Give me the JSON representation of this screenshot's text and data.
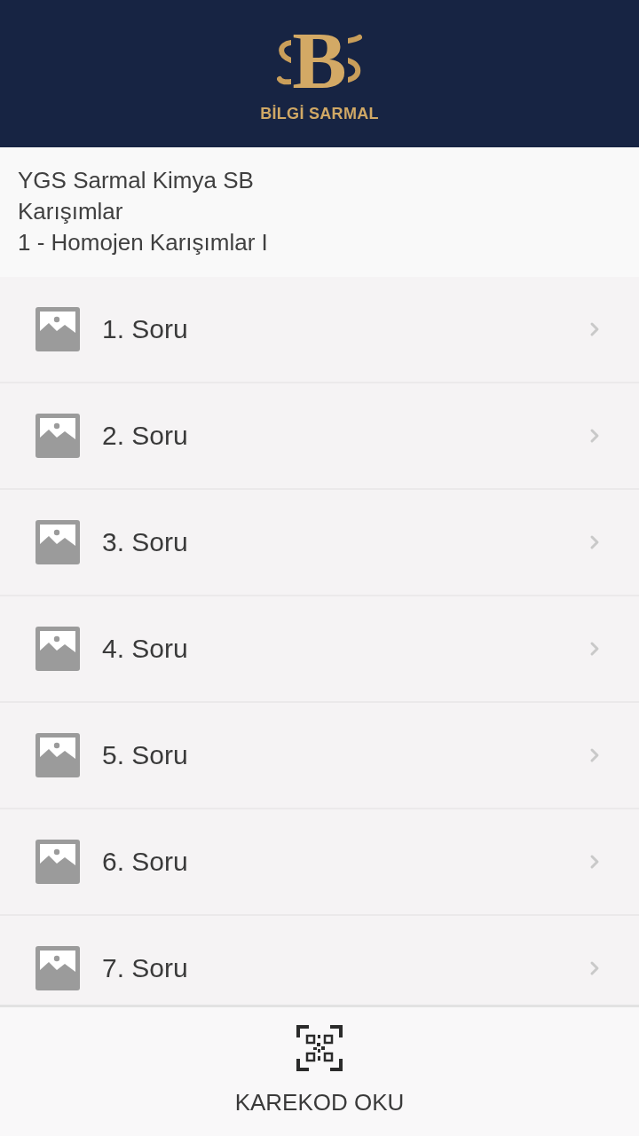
{
  "header": {
    "logo": {
      "monogram": "B",
      "wordmark": "BİLGİ SARMAL"
    }
  },
  "breadcrumb": [
    "YGS Sarmal Kimya SB",
    "Karışımlar",
    "1 - Homojen Karışımlar I"
  ],
  "questions": [
    {
      "label": "1. Soru"
    },
    {
      "label": "2. Soru"
    },
    {
      "label": "3. Soru"
    },
    {
      "label": "4. Soru"
    },
    {
      "label": "5. Soru"
    },
    {
      "label": "6. Soru"
    },
    {
      "label": "7. Soru"
    }
  ],
  "bottom_bar": {
    "button": "KAREKOD OKU"
  }
}
